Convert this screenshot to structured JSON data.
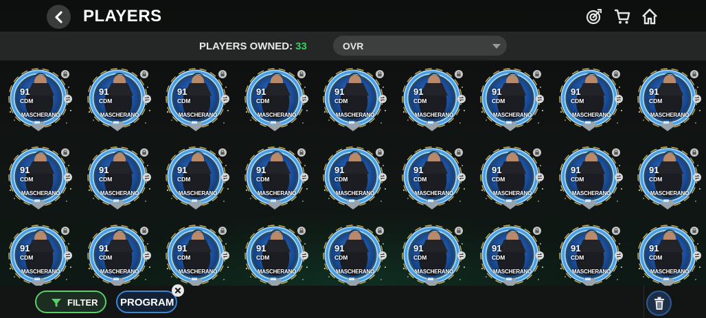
{
  "header": {
    "title": "PLAYERS",
    "icons": [
      "back-arrow-icon",
      "objectives-target-icon",
      "store-cart-icon",
      "home-icon"
    ]
  },
  "subbar": {
    "owned_label": "PLAYERS OWNED:",
    "owned_count": "33",
    "sort_value": "OVR"
  },
  "cards": [
    {
      "ovr": "91",
      "pos": "CDM",
      "name": "MASCHERANO"
    },
    {
      "ovr": "91",
      "pos": "CDM",
      "name": "MASCHERANO"
    },
    {
      "ovr": "91",
      "pos": "CDM",
      "name": "MASCHERANO"
    },
    {
      "ovr": "91",
      "pos": "CDM",
      "name": "MASCHERANO"
    },
    {
      "ovr": "91",
      "pos": "CDM",
      "name": "MASCHERANO"
    },
    {
      "ovr": "91",
      "pos": "CDM",
      "name": "MASCHERANO"
    },
    {
      "ovr": "91",
      "pos": "CDM",
      "name": "MASCHERANO"
    },
    {
      "ovr": "91",
      "pos": "CDM",
      "name": "MASCHERANO"
    },
    {
      "ovr": "91",
      "pos": "CDM",
      "name": "MASCHERANO"
    },
    {
      "ovr": "91",
      "pos": "CDM",
      "name": "MASCHERANO"
    },
    {
      "ovr": "91",
      "pos": "CDM",
      "name": "MASCHERANO"
    },
    {
      "ovr": "91",
      "pos": "CDM",
      "name": "MASCHERANO"
    },
    {
      "ovr": "91",
      "pos": "CDM",
      "name": "MASCHERANO"
    },
    {
      "ovr": "91",
      "pos": "CDM",
      "name": "MASCHERANO"
    },
    {
      "ovr": "91",
      "pos": "CDM",
      "name": "MASCHERANO"
    },
    {
      "ovr": "91",
      "pos": "CDM",
      "name": "MASCHERANO"
    },
    {
      "ovr": "91",
      "pos": "CDM",
      "name": "MASCHERANO"
    },
    {
      "ovr": "91",
      "pos": "CDM",
      "name": "MASCHERANO"
    },
    {
      "ovr": "91",
      "pos": "CDM",
      "name": "MASCHERANO"
    },
    {
      "ovr": "91",
      "pos": "CDM",
      "name": "MASCHERANO"
    },
    {
      "ovr": "91",
      "pos": "CDM",
      "name": "MASCHERANO"
    },
    {
      "ovr": "91",
      "pos": "CDM",
      "name": "MASCHERANO"
    },
    {
      "ovr": "91",
      "pos": "CDM",
      "name": "MASCHERANO"
    },
    {
      "ovr": "91",
      "pos": "CDM",
      "name": "MASCHERANO"
    },
    {
      "ovr": "91",
      "pos": "CDM",
      "name": "MASCHERANO"
    },
    {
      "ovr": "91",
      "pos": "CDM",
      "name": "MASCHERANO"
    },
    {
      "ovr": "91",
      "pos": "CDM",
      "name": "MASCHERANO"
    }
  ],
  "footer": {
    "filter_label": "FILTER",
    "program_chip_label": "PROGRAM",
    "icons": [
      "filter-funnel-icon",
      "close-x-icon",
      "trash-icon"
    ]
  },
  "colors": {
    "accent_green": "#35d05a",
    "filter_border": "#57d16a",
    "program_border": "#3c86d8",
    "card_blue": "#4a9ee0"
  }
}
